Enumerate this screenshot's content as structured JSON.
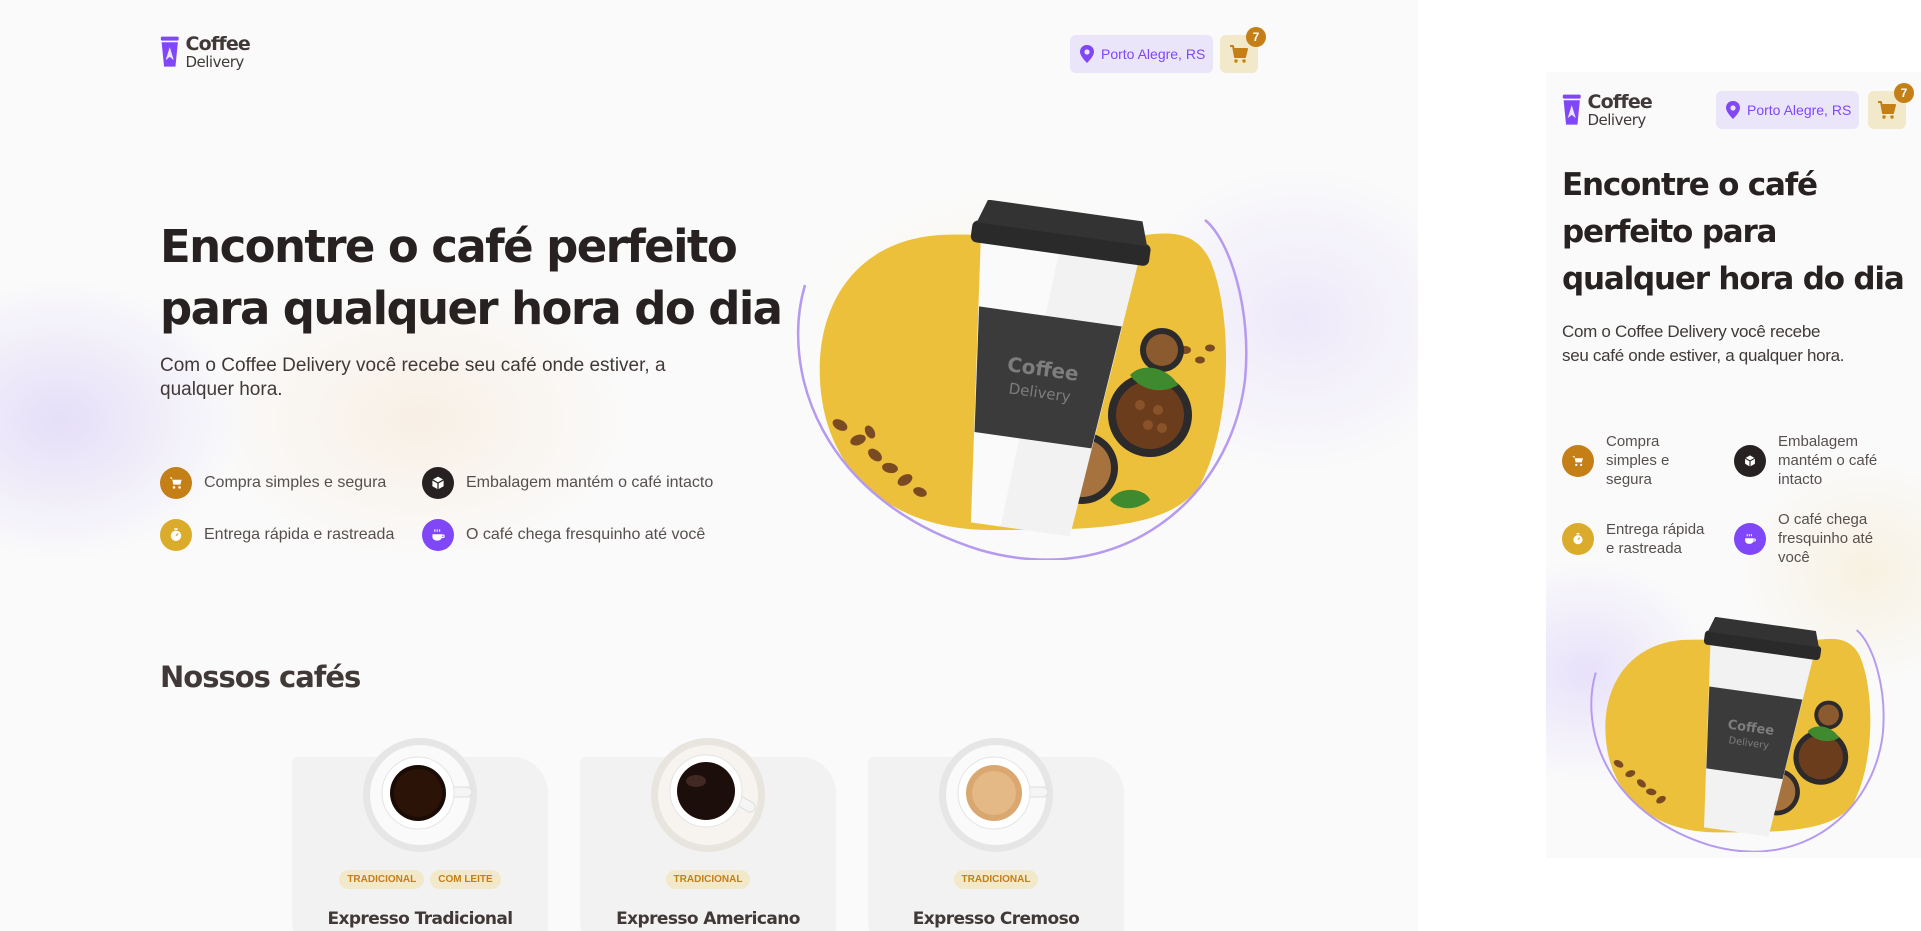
{
  "brand": {
    "name_line1": "Coffee",
    "name_line2": "Delivery"
  },
  "header": {
    "location": "Porto Alegre, RS",
    "cart_count": "7"
  },
  "hero": {
    "title_line1": "Encontre o café perfeito",
    "title_line2": "para qualquer hora do dia",
    "subtitle_line1": "Com o Coffee Delivery você recebe seu café onde estiver, a",
    "subtitle_line2": "qualquer hora.",
    "features": [
      {
        "label": "Compra simples e segura",
        "icon": "cart-icon",
        "color": "#c47f17"
      },
      {
        "label": "Embalagem mantém o café intacto",
        "icon": "package-icon",
        "color": "#272221"
      },
      {
        "label": "Entrega rápida e rastreada",
        "icon": "timer-icon",
        "color": "#dbac2c"
      },
      {
        "label": "O café chega fresquinho até você",
        "icon": "coffee-icon",
        "color": "#8047f8"
      }
    ],
    "image_text": {
      "line1": "Coffee",
      "line2": "Delivery"
    }
  },
  "catalog": {
    "title": "Nossos cafés",
    "coffees": [
      {
        "name": "Expresso Tradicional",
        "tags": [
          "TRADICIONAL",
          "COM LEITE"
        ],
        "drink": "black"
      },
      {
        "name": "Expresso Americano",
        "tags": [
          "TRADICIONAL"
        ],
        "drink": "dark"
      },
      {
        "name": "Expresso Cremoso",
        "tags": [
          "TRADICIONAL"
        ],
        "drink": "cream"
      }
    ]
  },
  "mobile": {
    "title_lines": [
      "Encontre o café",
      "perfeito para",
      "qualquer hora do dia"
    ],
    "subtitle_lines": [
      "Com o Coffee Delivery você recebe",
      "seu café onde estiver, a qualquer hora."
    ],
    "feature_lines": [
      [
        "Compra",
        "simples e",
        "segura"
      ],
      [
        "Embalagem",
        "mantém o café",
        "intacto"
      ],
      [
        "Entrega rápida",
        "e rastreada"
      ],
      [
        "O café chega",
        "fresquinho até",
        "você"
      ]
    ]
  },
  "colors": {
    "yellow_dark": "#c47f17",
    "yellow": "#dbac2c",
    "yellow_light": "#f1e9c9",
    "purple": "#8047f8",
    "purple_light": "#ebe5f9",
    "title": "#272221"
  }
}
